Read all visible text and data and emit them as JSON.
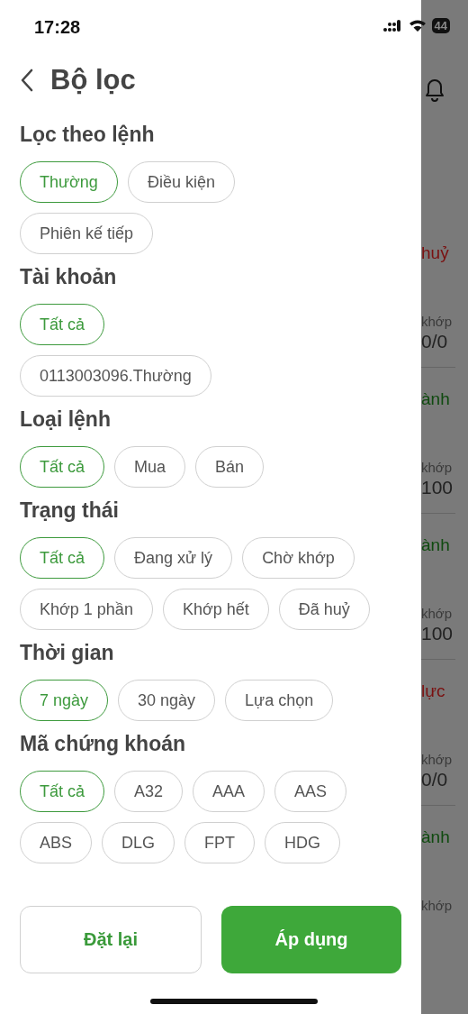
{
  "status_bar": {
    "time": "17:28",
    "battery": "44"
  },
  "header": {
    "title": "Bộ lọc"
  },
  "sections": [
    {
      "title": "Lọc theo lệnh",
      "chip_rows": [
        [
          {
            "label": "Thường",
            "selected": true
          },
          {
            "label": "Điều kiện",
            "selected": false
          }
        ],
        [
          {
            "label": "Phiên kế tiếp",
            "selected": false
          }
        ]
      ]
    },
    {
      "title": "Tài khoản",
      "chip_rows": [
        [
          {
            "label": "Tất cả",
            "selected": true
          }
        ],
        [
          {
            "label": "0113003096.Thường",
            "selected": false
          }
        ]
      ]
    },
    {
      "title": "Loại lệnh",
      "chip_rows": [
        [
          {
            "label": "Tất cả",
            "selected": true
          },
          {
            "label": "Mua",
            "selected": false
          },
          {
            "label": "Bán",
            "selected": false
          }
        ]
      ]
    },
    {
      "title": "Trạng thái",
      "chip_rows": [
        [
          {
            "label": "Tất cả",
            "selected": true
          },
          {
            "label": "Đang xử lý",
            "selected": false
          },
          {
            "label": "Chờ khớp",
            "selected": false
          }
        ],
        [
          {
            "label": "Khớp 1 phần",
            "selected": false
          },
          {
            "label": "Khớp hết",
            "selected": false
          },
          {
            "label": "Đã huỷ",
            "selected": false
          }
        ]
      ]
    },
    {
      "title": "Thời gian",
      "chip_rows": [
        [
          {
            "label": "7 ngày",
            "selected": true
          },
          {
            "label": "30 ngày",
            "selected": false
          },
          {
            "label": "Lựa chọn",
            "selected": false
          }
        ]
      ]
    },
    {
      "title": "Mã chứng khoán",
      "chip_rows": [
        [
          {
            "label": "Tất cả",
            "selected": true
          },
          {
            "label": "A32",
            "selected": false
          },
          {
            "label": "AAA",
            "selected": false
          },
          {
            "label": "AAS",
            "selected": false
          }
        ],
        [
          {
            "label": "ABS",
            "selected": false
          },
          {
            "label": "DLG",
            "selected": false
          },
          {
            "label": "FPT",
            "selected": false
          },
          {
            "label": "HDG",
            "selected": false
          }
        ]
      ]
    }
  ],
  "buttons": [
    {
      "label": "Đặt lại",
      "kind": "secondary"
    },
    {
      "label": "Áp dụng",
      "kind": "primary"
    }
  ],
  "background_orders": [
    {
      "status": "huỷ",
      "color": "#7a1010",
      "label": "khớp",
      "value": "0/0"
    },
    {
      "status": "ành",
      "color": "#0f4a0f",
      "label": "khớp",
      "value": "100"
    },
    {
      "status": "ành",
      "color": "#0f4a0f",
      "label": "khớp",
      "value": "100"
    },
    {
      "status": "lực",
      "color": "#7a1010",
      "label": "khớp",
      "value": "0/0"
    },
    {
      "status": "ành",
      "color": "#0f4a0f",
      "label": "khớp"
    }
  ]
}
